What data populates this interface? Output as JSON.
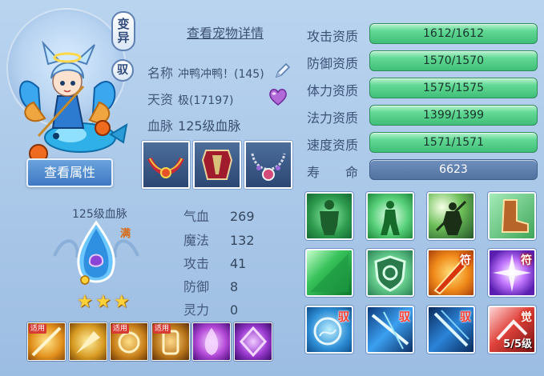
{
  "header": {
    "view_detail": "查看宠物详情",
    "tag_mutant": "变异",
    "tag_tame": "驭",
    "view_attr_button": "查看属性"
  },
  "info": {
    "name_label": "名称",
    "name_value": "冲鸭冲鸭！(145)",
    "talent_label": "天资",
    "talent_value": "极(17197)",
    "blood_label": "血脉",
    "blood_value": "125级血脉"
  },
  "aptitudes": [
    {
      "label": "攻击资质",
      "value": "1612/1612"
    },
    {
      "label": "防御资质",
      "value": "1570/1570"
    },
    {
      "label": "体力资质",
      "value": "1575/1575"
    },
    {
      "label": "法力资质",
      "value": "1399/1399"
    },
    {
      "label": "速度资质",
      "value": "1571/1571"
    },
    {
      "label": "寿　　命",
      "value": "6623"
    }
  ],
  "bloodline": {
    "title": "125级血脉",
    "full_badge": "满",
    "stars": 3
  },
  "stats": [
    {
      "label": "气血",
      "value": "269"
    },
    {
      "label": "魔法",
      "value": "132"
    },
    {
      "label": "攻击",
      "value": "41"
    },
    {
      "label": "防御",
      "value": "8"
    },
    {
      "label": "灵力",
      "value": "0"
    }
  ],
  "skills": {
    "badges": [
      "符",
      "符",
      "驭",
      "驭",
      "驭",
      "觉"
    ],
    "level": "5/5级"
  },
  "bottom_skills": {
    "badge": "适用"
  },
  "colors": {
    "aptitude_bar": "#4fcf86",
    "life_bar": "#5a7aa8",
    "button": "#4a82c8"
  }
}
